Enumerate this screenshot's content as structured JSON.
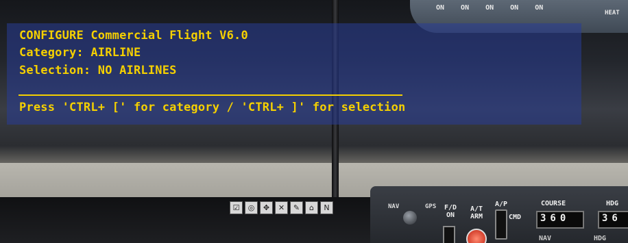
{
  "overhead_panel": {
    "switch_labels": [
      "ON",
      "ON",
      "ON",
      "ON",
      "ON"
    ],
    "heat_label": "HEAT"
  },
  "config_message": {
    "title": "CONFIGURE Commercial Flight V6.0",
    "category": "Category: AIRLINE",
    "selection": "Selection: NO AIRLINES",
    "instruction": "Press 'CTRL+ [' for category / 'CTRL+ ]' for selection"
  },
  "icon_bar": {
    "icons": [
      "checkbox-icon",
      "atc-icon",
      "gps-icon",
      "kneeboard-icon",
      "map-icon",
      "fuel-icon",
      "nav-icon"
    ],
    "glyphs": [
      "☑",
      "◎",
      "✥",
      "✕",
      "✎",
      "⌂",
      "N"
    ]
  },
  "autopilot": {
    "nav_label": "NAV",
    "gps_label": "GPS",
    "fd_label": "F/D",
    "fd_state": "ON",
    "at_label": "A/T",
    "at_state": "ARM",
    "ap_label": "A/P",
    "cmd_label": "CMD",
    "course_label": "COURSE",
    "course_value": "360",
    "hdg_label": "HDG",
    "hdg_value": "36",
    "nav_sub_label": "NAV",
    "hdg_sub_label": "HDG"
  },
  "colors": {
    "message_text": "#f5d000",
    "message_bg": "#283c96"
  }
}
